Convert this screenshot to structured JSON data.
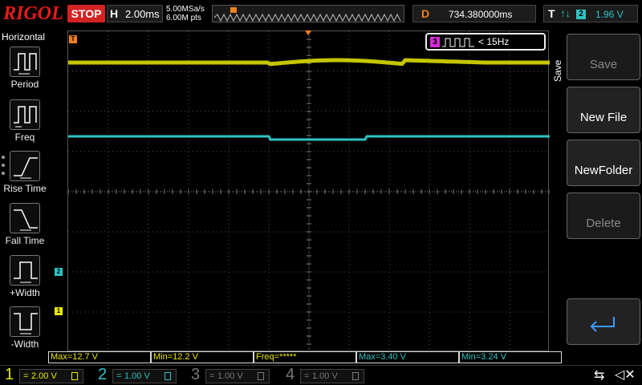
{
  "header": {
    "brand": "RIGOL",
    "run_state": "STOP",
    "horizontal": {
      "label": "H",
      "timebase": "2.00ms"
    },
    "sample_rate": "5.00MSa/s",
    "memory_depth": "6.00M pts",
    "delay": {
      "label": "D",
      "value": "734.380000ms"
    },
    "trigger": {
      "label": "T",
      "edge": "↑↓",
      "source": "2",
      "level": "1.96 V"
    }
  },
  "left_menu": {
    "title": "Horizontal",
    "items": [
      {
        "label": "Period",
        "icon": "period-icon"
      },
      {
        "label": "Freq",
        "icon": "freq-icon"
      },
      {
        "label": "Rise Time",
        "icon": "rise-time-icon"
      },
      {
        "label": "Fall Time",
        "icon": "fall-time-icon"
      },
      {
        "label": "+Width",
        "icon": "positive-width-icon"
      },
      {
        "label": "-Width",
        "icon": "negative-width-icon"
      }
    ]
  },
  "right_menu": {
    "title": "Save",
    "buttons": [
      {
        "label": "Save",
        "enabled": false
      },
      {
        "label": "New File",
        "enabled": true
      },
      {
        "label": "NewFolder",
        "enabled": true
      },
      {
        "label": "Delete",
        "enabled": false
      },
      {
        "label": "",
        "icon": "return-arrow-icon",
        "enabled": true
      }
    ]
  },
  "frequency_counter": {
    "channel": "3",
    "value": "< 15Hz"
  },
  "markers": {
    "trigger_position": "T",
    "trigger_level": "T",
    "ch1_offset": "1",
    "ch2_offset": "2"
  },
  "measurements": [
    {
      "label": "Max=12.7 V",
      "channel": 1
    },
    {
      "label": "Min=12.2 V",
      "channel": 1
    },
    {
      "label": "Freq=*****",
      "channel": 1
    },
    {
      "label": "Max=3.40 V",
      "channel": 2
    },
    {
      "label": "Min=3.24 V",
      "channel": 2
    }
  ],
  "channels": [
    {
      "num": "1",
      "coupling": "=",
      "scale": "2.00 V",
      "color": "#e8e800",
      "active": true
    },
    {
      "num": "2",
      "coupling": "=",
      "scale": "1.00 V",
      "color": "#2ec4c4",
      "active": true
    },
    {
      "num": "3",
      "coupling": "=",
      "scale": "1.00 V",
      "color": "#777777",
      "active": false
    },
    {
      "num": "4",
      "coupling": "=",
      "scale": "1.00 V",
      "color": "#777777",
      "active": false
    }
  ],
  "colors": {
    "ch1": "#e8e800",
    "ch2": "#2ec4c4",
    "ch3": "#d22ad2",
    "trigger": "#f08020",
    "stop": "#d32323"
  },
  "status_icons": [
    "usb-icon",
    "mute-icon"
  ]
}
